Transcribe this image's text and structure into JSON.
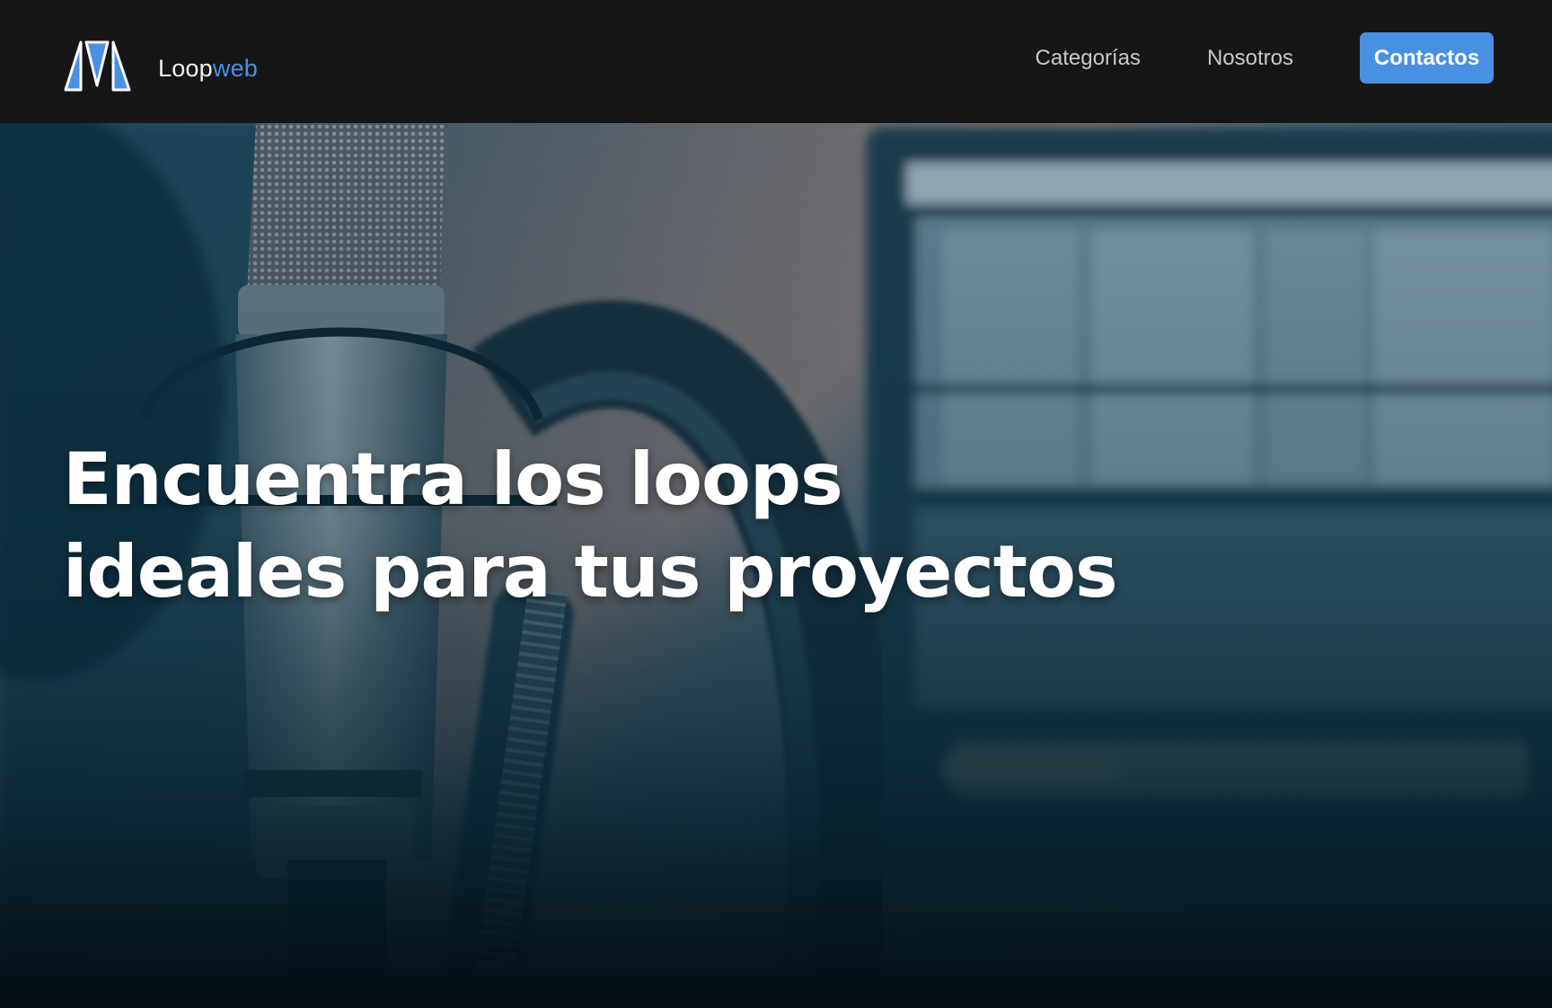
{
  "brand": {
    "name_part1": "Loop",
    "name_part2": "web",
    "logo_icon": "loopweb-logo-icon"
  },
  "nav": {
    "categories_label": "Categorías",
    "about_label": "Nosotros",
    "contact_label": "Contactos"
  },
  "hero": {
    "title_line1": "Encuentra los loops",
    "title_line2": "ideales para tus proyectos",
    "background_image": "studio microphone, headphones and monitor"
  },
  "colors": {
    "accent": "#4a90e2",
    "header_bg": "#161617",
    "hero_tint": "#0e3346"
  }
}
